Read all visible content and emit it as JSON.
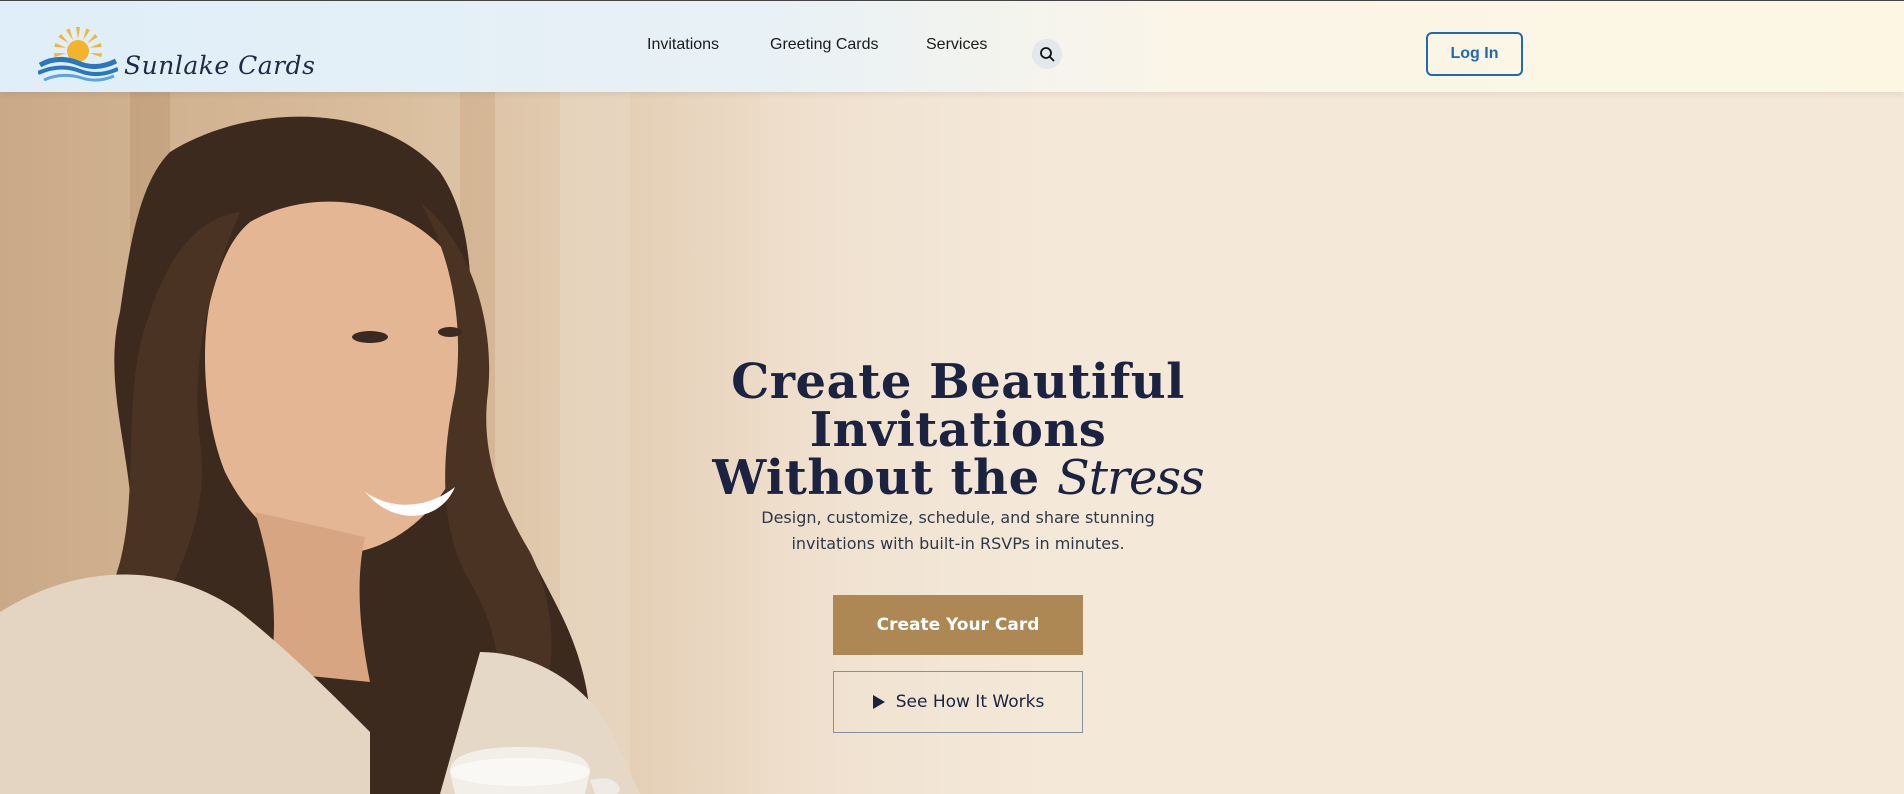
{
  "brand": {
    "name": "Sunlake Cards"
  },
  "nav": {
    "items": [
      {
        "label": "Invitations"
      },
      {
        "label": "Greeting Cards"
      },
      {
        "label": "Services"
      }
    ],
    "login_label": "Log In"
  },
  "hero": {
    "title_line1": "Create Beautiful Invitations",
    "title_line2_prefix": "Without the",
    "title_line2_script": "Stress",
    "subtitle_line1": "Design, customize, schedule, and share stunning",
    "subtitle_line2": "invitations with built-in RSVPs in minutes.",
    "primary_cta": "Create Your Card",
    "secondary_cta": "See How It Works"
  },
  "colors": {
    "accent_gold": "#ad8754",
    "login_blue": "#1f6bb0",
    "title_navy": "#1b2340"
  },
  "icons": {
    "search": "search-icon",
    "play": "play-icon",
    "logo_sun": "sun-logo-icon"
  }
}
